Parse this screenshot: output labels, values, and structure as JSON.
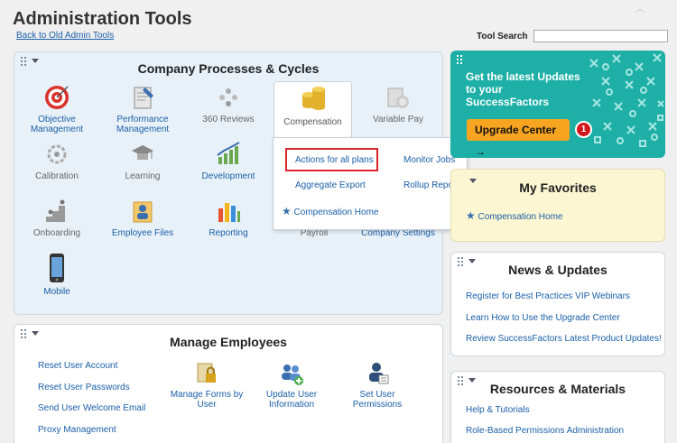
{
  "header": {
    "title": "Administration Tools",
    "back_link": "Back to Old Admin Tools",
    "tool_search_label": "Tool Search",
    "tool_search_value": ""
  },
  "company_processes": {
    "title": "Company Processes & Cycles",
    "tiles": [
      {
        "label": "Objective Management",
        "icon": "target-icon"
      },
      {
        "label": "Performance Management",
        "icon": "clipboard-icon"
      },
      {
        "label": "360 Reviews",
        "icon": "people-icon"
      },
      {
        "label": "Compensation",
        "icon": "coins-icon"
      },
      {
        "label": "Variable Pay",
        "icon": "cash-icon"
      },
      {
        "label": "Calibration",
        "icon": "gear-people-icon"
      },
      {
        "label": "Learning",
        "icon": "graduation-icon"
      },
      {
        "label": "Development",
        "icon": "growth-chart-icon"
      },
      {
        "label": "Onboarding",
        "icon": "stairs-icon"
      },
      {
        "label": "Employee Files",
        "icon": "employee-file-icon"
      },
      {
        "label": "Reporting",
        "icon": "bar-chart-icon"
      },
      {
        "label": "Payroll",
        "icon": "payroll-icon"
      },
      {
        "label": "Company Settings",
        "icon": "settings-icon"
      },
      {
        "label": "Mobile",
        "icon": "phone-icon"
      }
    ],
    "compensation_menu": {
      "actions_for_all_plans": "Actions for all plans",
      "monitor_jobs": "Monitor Jobs",
      "aggregate_export": "Aggregate Export",
      "rollup_report": "Rollup Report",
      "compensation_home": "Compensation Home"
    }
  },
  "manage_employees": {
    "title": "Manage Employees",
    "links": [
      "Reset User Account",
      "Reset User Passwords",
      "Send User Welcome Email",
      "Proxy Management"
    ],
    "tiles": [
      {
        "label": "Manage Forms by User",
        "icon": "forms-lock-icon"
      },
      {
        "label": "Update User Information",
        "icon": "update-users-icon"
      },
      {
        "label": "Set User Permissions",
        "icon": "user-permissions-icon"
      }
    ]
  },
  "banner": {
    "line1": "Get the latest Updates",
    "line2": "to your",
    "line3": "SuccessFactors",
    "button": "Upgrade Center →",
    "badge": "1",
    "colors": {
      "background": "#1eb0a7",
      "button": "#f7a521",
      "badge": "#d0171d"
    }
  },
  "favorites": {
    "title": "My Favorites",
    "items": [
      "Compensation Home"
    ]
  },
  "news": {
    "title": "News & Updates",
    "items": [
      "Register for Best Practices VIP Webinars",
      "Learn How to Use the Upgrade Center",
      "Review SuccessFactors Latest Product Updates!"
    ]
  },
  "resources": {
    "title": "Resources & Materials",
    "items": [
      "Help & Tutorials",
      "Role-Based Permissions Administration"
    ]
  }
}
